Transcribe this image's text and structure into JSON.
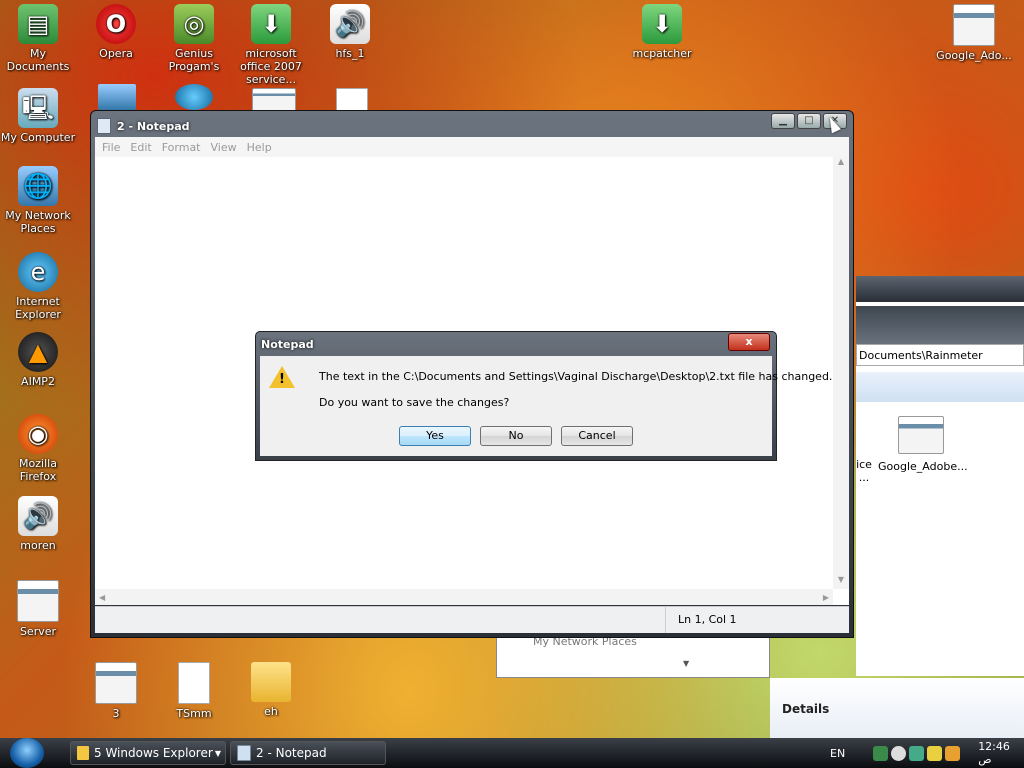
{
  "desktop": {
    "icons_top": [
      {
        "label": "My Documents",
        "icon": "documents-icon"
      },
      {
        "label": "Opera",
        "icon": "opera-icon"
      },
      {
        "label": "Genius Progam's",
        "icon": "genius-icon"
      },
      {
        "label": "microsoft office 2007 service...",
        "icon": "installer-icon"
      },
      {
        "label": "hfs_1",
        "icon": "speaker-icon"
      },
      {
        "label": "mcpatcher",
        "icon": "installer-icon"
      },
      {
        "label": "Google_Ado...",
        "icon": "window-icon"
      }
    ],
    "icons_left": [
      {
        "label": "My Computer",
        "icon": "computer-icon"
      },
      {
        "label": "My Network Places",
        "icon": "network-icon"
      },
      {
        "label": "Internet Explorer",
        "icon": "ie-icon"
      },
      {
        "label": "AIMP2",
        "icon": "aimp-icon"
      },
      {
        "label": "Mozilla Firefox",
        "icon": "firefox-icon"
      },
      {
        "label": "moren",
        "icon": "speaker-icon"
      },
      {
        "label": "Server",
        "icon": "window-icon"
      }
    ],
    "icons_bottom": [
      {
        "label": "3",
        "icon": "window-icon"
      },
      {
        "label": "TSmm",
        "icon": "file-icon"
      },
      {
        "label": "eh",
        "icon": "folder-icon"
      }
    ]
  },
  "notepad": {
    "title": "2 - Notepad",
    "menu": [
      "File",
      "Edit",
      "Format",
      "View",
      "Help"
    ],
    "status": "Ln 1, Col 1"
  },
  "explorer_bg": {
    "address": "Documents\\Rainmeter",
    "items": [
      "ice\n...",
      "Google_Adobe..."
    ],
    "nav_item": "My Network Places",
    "details": "Details"
  },
  "dialog": {
    "title": "Notepad",
    "close": "x",
    "message": "The text in the C:\\Documents and Settings\\Vaginal Discharge\\Desktop\\2.txt file has changed.",
    "question": "Do you want to save the changes?",
    "yes": "Yes",
    "no": "No",
    "cancel": "Cancel"
  },
  "taskbar": {
    "buttons": [
      {
        "label": "5 Windows Explorer"
      },
      {
        "label": "2 - Notepad"
      }
    ],
    "lang": "EN",
    "clock": "12:46 ص"
  }
}
